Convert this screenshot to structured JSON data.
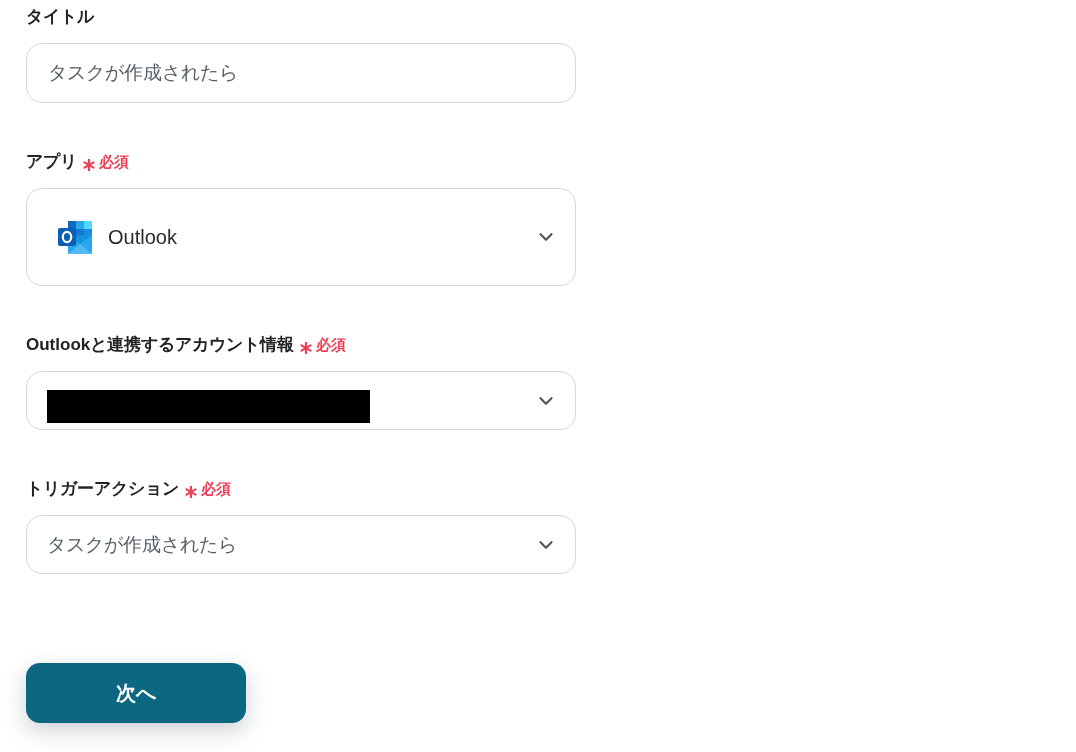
{
  "form": {
    "fields": [
      {
        "kind": "text",
        "label": "タイトル",
        "required": false,
        "value": "タスクが作成されたら"
      },
      {
        "kind": "app-select",
        "label": "アプリ",
        "required": true,
        "required_label": "必須",
        "value": "Outlook"
      },
      {
        "kind": "select",
        "label": "Outlookと連携するアカウント情報",
        "required": true,
        "required_label": "必須",
        "redacted": true
      },
      {
        "kind": "select",
        "label": "トリガーアクション",
        "required": true,
        "required_label": "必須",
        "value": "タスクが作成されたら"
      }
    ]
  },
  "buttons": [
    {
      "label": "次へ"
    }
  ]
}
